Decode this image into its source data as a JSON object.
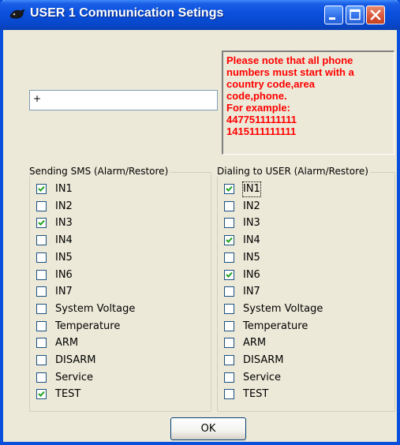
{
  "window": {
    "title": "USER 1 Communication Setings"
  },
  "phone_input": {
    "value": "+"
  },
  "note": {
    "lines": [
      "Please note that all phone",
      "numbers must  start with a",
      "country code,area",
      "code,phone.",
      "For example:",
      "4477511111111",
      "1415111111111"
    ],
    "color": "#ff0000"
  },
  "sms_group": {
    "title": "Sending SMS (Alarm/Restore)",
    "items": [
      {
        "label": "IN1",
        "checked": true
      },
      {
        "label": "IN2",
        "checked": false
      },
      {
        "label": "IN3",
        "checked": true
      },
      {
        "label": "IN4",
        "checked": false
      },
      {
        "label": "IN5",
        "checked": false
      },
      {
        "label": "IN6",
        "checked": false
      },
      {
        "label": "IN7",
        "checked": false
      },
      {
        "label": "System Voltage",
        "checked": false
      },
      {
        "label": "Temperature",
        "checked": false
      },
      {
        "label": "ARM",
        "checked": false
      },
      {
        "label": "DISARM",
        "checked": false
      },
      {
        "label": "Service",
        "checked": false
      },
      {
        "label": "TEST",
        "checked": true
      }
    ]
  },
  "dial_group": {
    "title": "Dialing to USER (Alarm/Restore)",
    "items": [
      {
        "label": "IN1",
        "checked": true
      },
      {
        "label": "IN2",
        "checked": false
      },
      {
        "label": "IN3",
        "checked": false
      },
      {
        "label": "IN4",
        "checked": true
      },
      {
        "label": "IN5",
        "checked": false
      },
      {
        "label": "IN6",
        "checked": true
      },
      {
        "label": "IN7",
        "checked": false
      },
      {
        "label": "System Voltage",
        "checked": false
      },
      {
        "label": "Temperature",
        "checked": false
      },
      {
        "label": "ARM",
        "checked": false
      },
      {
        "label": "DISARM",
        "checked": false
      },
      {
        "label": "Service",
        "checked": false
      },
      {
        "label": "TEST",
        "checked": false
      }
    ]
  },
  "ok_button": {
    "label": "OK"
  }
}
